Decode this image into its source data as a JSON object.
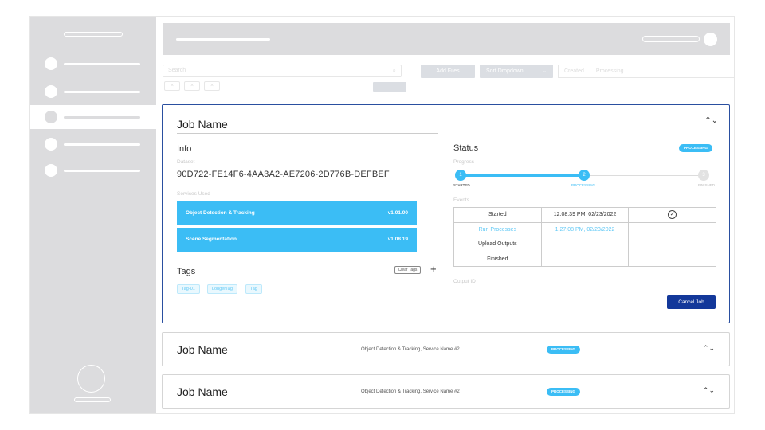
{
  "toolbar": {
    "search_placeholder": "Search",
    "search_icon": "search-icon",
    "add_files_label": "Add Files",
    "sort_label": "Sort Dropdown",
    "filters": [
      "Created",
      "Processing",
      ""
    ],
    "chips": [
      "×",
      "×",
      "×"
    ]
  },
  "expanded_job": {
    "title": "Job Name",
    "info_heading": "Info",
    "dataset_label": "Dataset",
    "dataset_id": "90D722-FE14F6-4AA3A2-AE7206-2D776B-DEFBEF",
    "services_label": "Services Used",
    "services": [
      {
        "name": "Object Detection & Tracking",
        "version": "v1.01.00"
      },
      {
        "name": "Scene Segmentation",
        "version": "v1.08.19"
      }
    ],
    "tags_heading": "Tags",
    "clear_tags_label": "Clear Tags",
    "add_tag_symbol": "+",
    "tags": [
      "Tag-01",
      "LongerTag",
      "Tag"
    ],
    "status_heading": "Status",
    "status_badge": "PROCESSING",
    "progress_label": "Progress",
    "progress": 0.5,
    "steps": [
      {
        "number": "1",
        "label": "STARTED"
      },
      {
        "number": "2",
        "label": "PROCESSING"
      },
      {
        "number": "3",
        "label": "FINISHED"
      }
    ],
    "events_label": "Events",
    "events": [
      {
        "name": "Started",
        "time": "12:08:39 PM, 02/23/2022",
        "done": true
      },
      {
        "name": "Run Processes",
        "time": "1:27:08 PM, 02/23/2022",
        "done": false
      },
      {
        "name": "Upload Outputs",
        "time": "",
        "done": false
      },
      {
        "name": "Finished",
        "time": "",
        "done": false
      }
    ],
    "check_symbol": "✓",
    "output_id_label": "Output ID",
    "cancel_label": "Cancel Job",
    "collapse_symbol": "⌃⌄"
  },
  "job_rows": [
    {
      "title": "Job Name",
      "services": "Object Detection & Tracking, Service Name #2",
      "status": "PROCESSING"
    },
    {
      "title": "Job Name",
      "services": "Object Detection & Tracking, Service Name #2",
      "status": "PROCESSING"
    }
  ],
  "expand_symbol": "⌃⌄",
  "colors": {
    "accent": "#3bbdf5",
    "primary": "#13389a",
    "wireframe": "#dcdcde"
  }
}
